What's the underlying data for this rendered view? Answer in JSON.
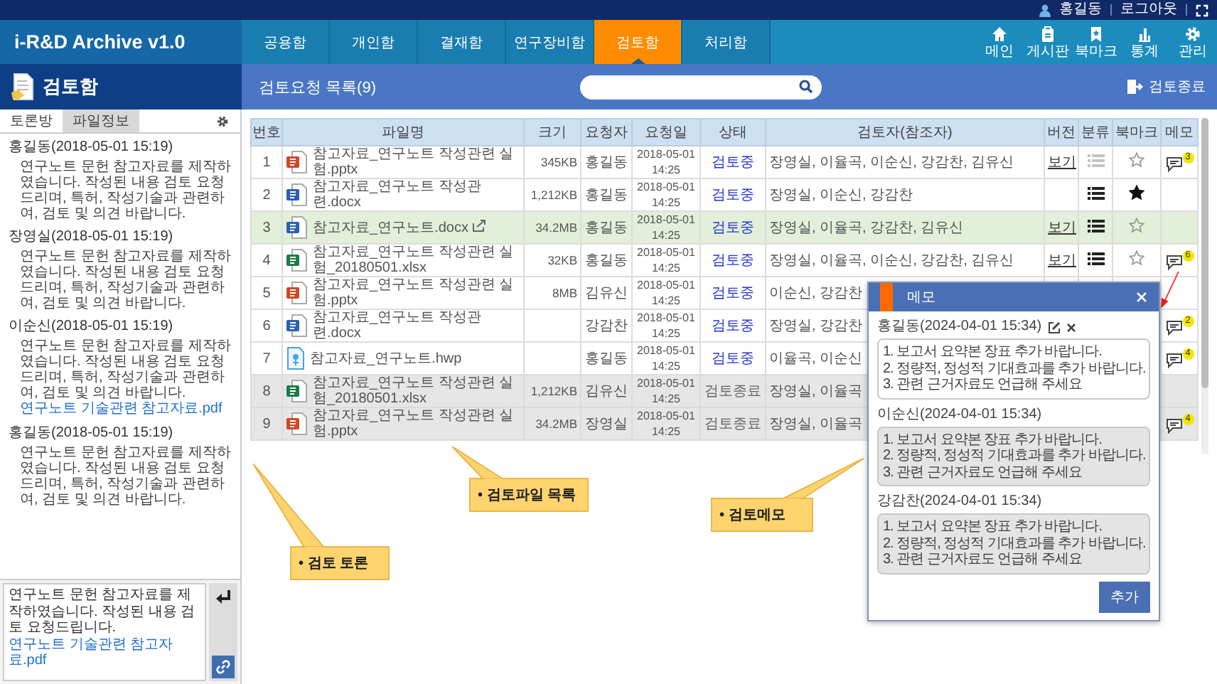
{
  "top_bar": {
    "user": "홍길동",
    "logout": "로그아웃"
  },
  "app": {
    "title": "i-R&D Archive v1.0"
  },
  "nav": {
    "tabs": [
      {
        "label": "공용함",
        "selected": false
      },
      {
        "label": "개인함",
        "selected": false
      },
      {
        "label": "결재함",
        "selected": false
      },
      {
        "label": "연구장비함",
        "selected": false
      },
      {
        "label": "검토함",
        "selected": true
      },
      {
        "label": "처리함",
        "selected": false
      }
    ],
    "shortcuts": [
      {
        "label": "메인",
        "kind": "home"
      },
      {
        "label": "게시판",
        "kind": "board"
      },
      {
        "label": "북마크",
        "kind": "bookmark"
      },
      {
        "label": "통계",
        "kind": "stats"
      },
      {
        "label": "관리",
        "kind": "settings"
      }
    ]
  },
  "sidebar": {
    "title": "검토함",
    "tabs": [
      {
        "label": "토론방",
        "selected": true
      },
      {
        "label": "파일정보",
        "selected": false
      }
    ],
    "comments": [
      {
        "author": "홍길동(2018-05-01 15:19)",
        "text": "연구노트 문헌 참고자료를 제작하였습니다. 작성된 내용 검토 요청드리며, 특허, 작성기술과 관련하여, 검토 및 의견 바랍니다."
      },
      {
        "author": "장영실(2018-05-01 15:19)",
        "text": "연구노트 문헌 참고자료를 제작하였습니다. 작성된 내용 검토 요청드리며, 특허, 작성기술과 관련하여, 검토 및 의견 바랍니다."
      },
      {
        "author": "이순신(2018-05-01 15:19)",
        "text": "연구노트 문헌 참고자료를 제작하였습니다. 작성된 내용 검토 요청드리며, 특허, 작성기술과 관련하여, 검토 및 의견 바랍니다.",
        "attachment": "연구노트 기술관련 참고자료.pdf"
      },
      {
        "author": "홍길동(2018-05-01 15:19)",
        "text": "연구노트 문헌 참고자료를 제작하였습니다. 작성된 내용 검토 요청드리며, 특허, 작성기술과 관련하여, 검토 및 의견 바랍니다."
      }
    ],
    "composer": {
      "value": "연구노트 문헌 참고자료를 제작하였습니다. 작성된 내용 검토 요청드립니다.",
      "attachment": "연구노트 기술관련 참고자료.pdf"
    }
  },
  "list": {
    "title": "검토요청 목록(9)",
    "close_button": "검토종료"
  },
  "table": {
    "columns": [
      "번호",
      "파일명",
      "크기",
      "요청자",
      "요청일",
      "상태",
      "검토자(참조자)",
      "버전",
      "분류",
      "북마크",
      "메모"
    ],
    "rows": [
      {
        "no": "1",
        "kind": "pptx",
        "name": "참고자료_연구노트 작성관련 실험.pptx",
        "shared": false,
        "size": "345KB",
        "requester": "홍길동",
        "date": "2018-05-01 14:25",
        "status": "검토중",
        "closed": false,
        "selected": false,
        "reviewers": "장영실, 이율곡, 이순신, 강감찬, 김유신",
        "version": "보기",
        "category_disabled": true,
        "bookmarked": false,
        "memo_count": "3"
      },
      {
        "no": "2",
        "kind": "docx",
        "name": "참고자료_연구노트 작성관련.docx",
        "shared": false,
        "size": "1,212KB",
        "requester": "홍길동",
        "date": "2018-05-01 14:25",
        "status": "검토중",
        "closed": false,
        "selected": false,
        "reviewers": "장영실, 이순신, 강감찬",
        "category_disabled": false,
        "bookmarked": true
      },
      {
        "no": "3",
        "kind": "docx",
        "name": "참고자료_연구노트.docx",
        "shared": true,
        "size": "34.2MB",
        "requester": "홍길동",
        "date": "2018-05-01 14:25",
        "status": "검토중",
        "closed": false,
        "selected": true,
        "reviewers": "장영실, 이율곡, 강감찬, 김유신",
        "version": "보기",
        "category_disabled": false,
        "bookmarked": false
      },
      {
        "no": "4",
        "kind": "xlsx",
        "name": "참고자료_연구노트 작성관련 실험_20180501.xlsx",
        "shared": false,
        "size": "32KB",
        "requester": "홍길동",
        "date": "2018-05-01 14:25",
        "status": "검토중",
        "closed": false,
        "selected": false,
        "reviewers": "장영실, 이율곡, 이순신, 강감찬, 김유신",
        "version": "보기",
        "category_disabled": false,
        "bookmarked": false,
        "memo_count": "6"
      },
      {
        "no": "5",
        "kind": "pptx",
        "name": "참고자료_연구노트 작성관련 실험.pptx",
        "shared": false,
        "size": "8MB",
        "requester": "김유신",
        "date": "2018-05-01 14:25",
        "status": "검토중",
        "closed": false,
        "selected": false,
        "reviewers": "이순신, 강감찬"
      },
      {
        "no": "6",
        "kind": "docx",
        "name": "참고자료_연구노트 작성관련.docx",
        "shared": false,
        "requester": "강감찬",
        "date": "2018-05-01 14:25",
        "status": "검토중",
        "closed": false,
        "selected": false,
        "reviewers": "장영실, 강감찬",
        "memo_count": "2"
      },
      {
        "no": "7",
        "kind": "hwp",
        "name": "참고자료_연구노트.hwp",
        "shared": false,
        "requester": "홍길동",
        "date": "2018-05-01 14:25",
        "status": "검토중",
        "closed": false,
        "selected": false,
        "reviewers": "이율곡, 이순신",
        "memo_count": "4"
      },
      {
        "no": "8",
        "kind": "xlsx",
        "name": "참고자료_연구노트 작성관련 실험_20180501.xlsx",
        "shared": false,
        "size": "1,212KB",
        "requester": "김유신",
        "date": "2018-05-01 14:25",
        "status": "검토종료",
        "closed": true,
        "selected": false,
        "reviewers": "장영실, 이율곡"
      },
      {
        "no": "9",
        "kind": "pptx",
        "name": "참고자료_연구노트 작성관련 실험.pptx",
        "shared": false,
        "size": "34.2MB",
        "requester": "장영실",
        "date": "2018-05-01 14:25",
        "status": "검토종료",
        "closed": true,
        "selected": false,
        "reviewers": "장영실, 이율곡",
        "memo_count": "4"
      }
    ]
  },
  "memo_popup": {
    "title": "메모",
    "entries": [
      {
        "author": "홍길동(2024-04-01 15:34)",
        "editable": true,
        "lines": [
          "1.  보고서 요약본 장표 추가 바랍니다.",
          "2.  정량적, 정성적 기대효과를 추가 바랍니다.",
          "3.  관련 근거자료도 언급해 주세요"
        ]
      },
      {
        "author": "이순신(2024-04-01 15:34)",
        "editable": false,
        "lines": [
          "1.  보고서 요약본 장표 추가 바랍니다.",
          "2.  정량적, 정성적 기대효과를 추가 바랍니다.",
          "3.  관련 근거자료도 언급해 주세요"
        ]
      },
      {
        "author": "강감찬(2024-04-01 15:34)",
        "editable": false,
        "lines": [
          "1.  보고서 요약본 장표 추가 바랍니다.",
          "2.  정량적, 정성적 기대효과를 추가 바랍니다.",
          "3.  관련 근거자료도 언급해 주세요"
        ]
      }
    ],
    "add_button": "추가"
  },
  "callouts": [
    {
      "kind": "files",
      "text": "• 검토파일 목록"
    },
    {
      "kind": "discussion",
      "text": "• 검토 토론"
    },
    {
      "kind": "memo",
      "text": "• 검토메모"
    }
  ]
}
